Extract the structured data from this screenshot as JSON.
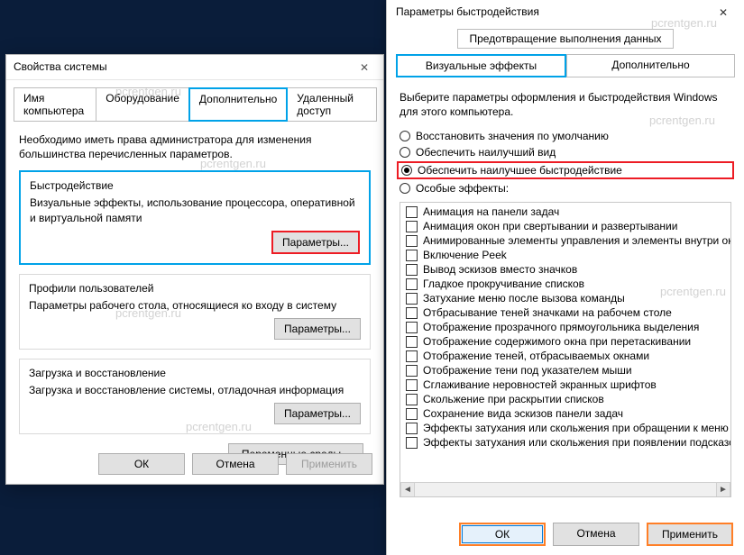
{
  "watermark": "pcrentgen.ru",
  "dlg1": {
    "title": "Свойства системы",
    "tabs": {
      "t0": "Имя компьютера",
      "t1": "Оборудование",
      "t2": "Дополнительно",
      "t3": "Удаленный доступ"
    },
    "admin_note": "Необходимо иметь права администратора для изменения большинства перечисленных параметров.",
    "perf": {
      "title": "Быстродействие",
      "desc": "Визуальные эффекты, использование процессора, оперативной и виртуальной памяти",
      "button": "Параметры..."
    },
    "profiles": {
      "title": "Профили пользователей",
      "desc": "Параметры рабочего стола, относящиеся ко входу в систему",
      "button": "Параметры..."
    },
    "startup": {
      "title": "Загрузка и восстановление",
      "desc": "Загрузка и восстановление системы, отладочная информация",
      "button": "Параметры..."
    },
    "env_button": "Переменные среды...",
    "footer": {
      "ok": "ОК",
      "cancel": "Отмена",
      "apply": "Применить"
    }
  },
  "dlg2": {
    "title": "Параметры быстродействия",
    "subtab_prev": "Предотвращение выполнения данных",
    "tabs": {
      "t0": "Визуальные эффекты",
      "t1": "Дополнительно"
    },
    "desc": "Выберите параметры оформления и быстродействия Windows для этого компьютера.",
    "radios": {
      "r0": "Восстановить значения по умолчанию",
      "r1": "Обеспечить наилучший вид",
      "r2": "Обеспечить наилучшее быстродействие",
      "r3": "Особые эффекты:"
    },
    "options": [
      "Анимация на панели задач",
      "Анимация окон при свертывании и развертывании",
      "Анимированные элементы управления и элементы внутри окн",
      "Включение Peek",
      "Вывод эскизов вместо значков",
      "Гладкое прокручивание списков",
      "Затухание меню после вызова команды",
      "Отбрасывание теней значками на рабочем столе",
      "Отображение прозрачного прямоугольника выделения",
      "Отображение содержимого окна при перетаскивании",
      "Отображение теней, отбрасываемых окнами",
      "Отображение тени под указателем мыши",
      "Сглаживание неровностей экранных шрифтов",
      "Скольжение при раскрытии списков",
      "Сохранение вида эскизов панели задач",
      "Эффекты затухания или скольжения при обращении к меню",
      "Эффекты затухания или скольжения при появлении подсказок"
    ],
    "footer": {
      "ok": "ОК",
      "cancel": "Отмена",
      "apply": "Применить"
    }
  }
}
